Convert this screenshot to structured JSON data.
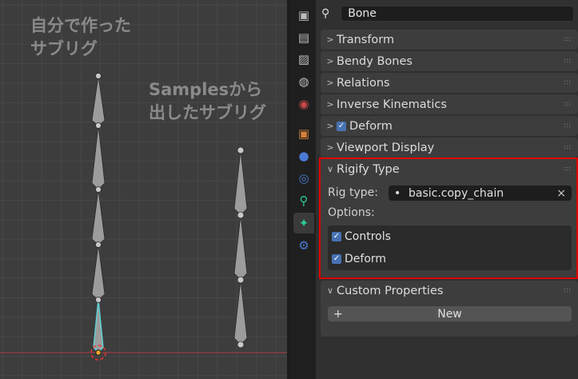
{
  "viewport": {
    "note_left": "自分で作った\nサブリグ",
    "note_right": "Samplesから\n出したサブリグ"
  },
  "properties": {
    "bone_name": "Bone",
    "panels": [
      {
        "label": "Transform",
        "expanded": false
      },
      {
        "label": "Bendy Bones",
        "expanded": false
      },
      {
        "label": "Relations",
        "expanded": false
      },
      {
        "label": "Inverse Kinematics",
        "expanded": false
      },
      {
        "label": "Deform",
        "expanded": false,
        "checked": true
      },
      {
        "label": "Viewport Display",
        "expanded": false
      }
    ],
    "rigify": {
      "title": "Rigify Type",
      "rig_type_label": "Rig type:",
      "rig_type_value": "basic.copy_chain",
      "options_label": "Options:",
      "options": [
        {
          "label": "Controls",
          "checked": true
        },
        {
          "label": "Deform",
          "checked": true
        }
      ]
    },
    "custom": {
      "title": "Custom Properties",
      "new_label": "New",
      "plus": "+"
    },
    "icons": {
      "check": "✓",
      "clear": "×",
      "dot": "•",
      "chev_right": ">",
      "chev_down": "∨"
    }
  },
  "colors": {
    "accent": "#4772b3",
    "highlight": "#e00000",
    "active_bone": "#5fd3d8"
  }
}
